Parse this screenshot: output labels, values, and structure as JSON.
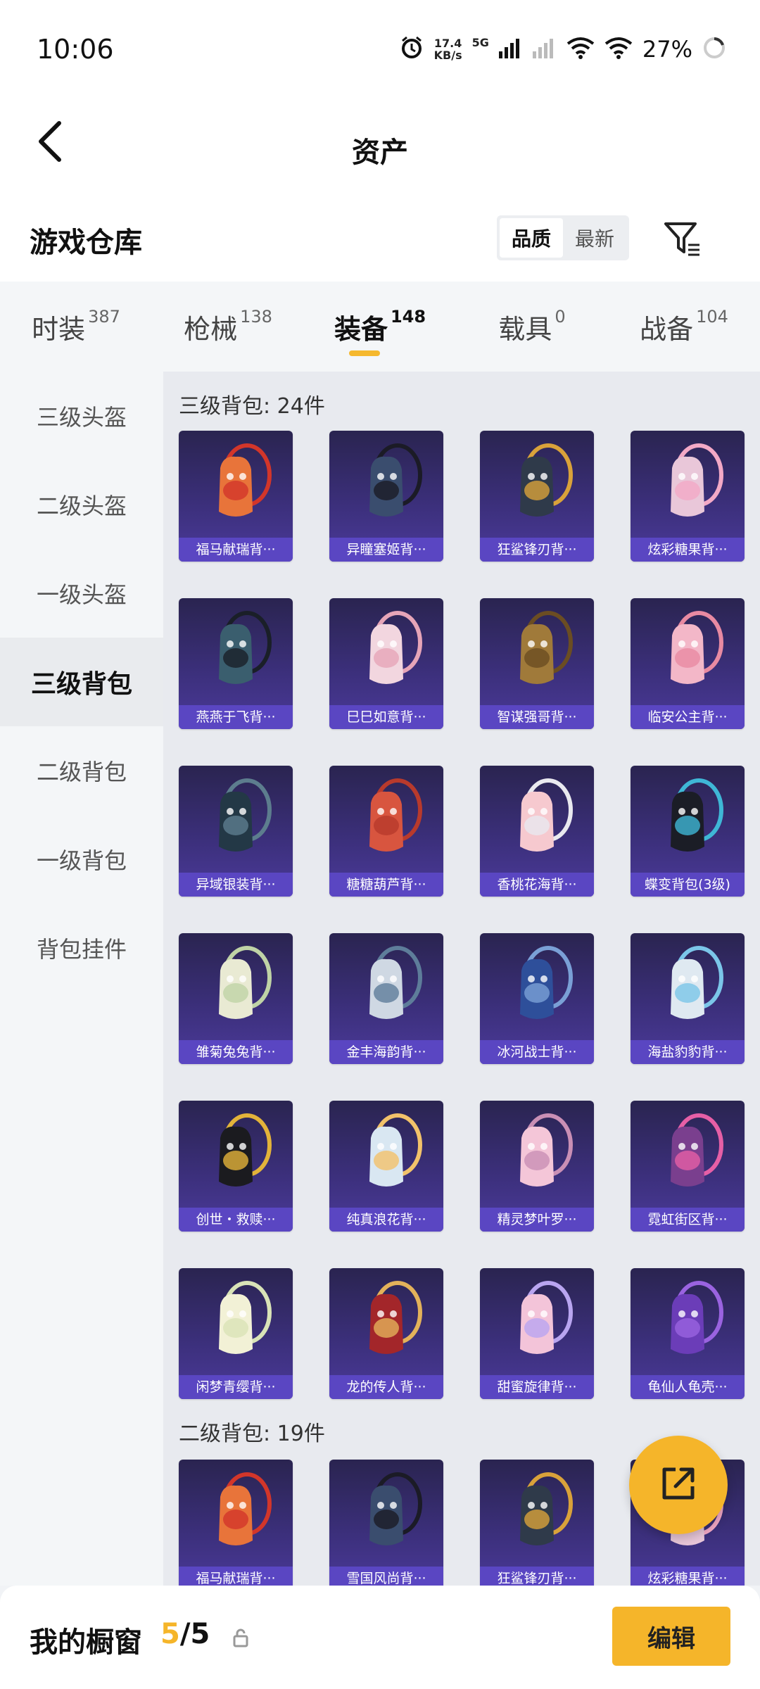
{
  "status_bar": {
    "time": "10:06",
    "net_speed_value": "17.4",
    "net_speed_unit": "KB/s",
    "network_tag": "5G",
    "battery": "27%"
  },
  "header": {
    "title": "资产"
  },
  "warehouse": {
    "title": "游戏仓库",
    "sort_options": [
      "品质",
      "最新"
    ],
    "active_sort": "品质"
  },
  "tabs": [
    {
      "label": "时装",
      "count": "387"
    },
    {
      "label": "枪械",
      "count": "138"
    },
    {
      "label": "装备",
      "count": "148",
      "active": true
    },
    {
      "label": "载具",
      "count": "0"
    },
    {
      "label": "战备",
      "count": "104"
    }
  ],
  "sidebar": {
    "items": [
      "三级头盔",
      "二级头盔",
      "一级头盔",
      "三级背包",
      "二级背包",
      "一级背包",
      "背包挂件"
    ],
    "active": "三级背包"
  },
  "sections": [
    {
      "title": "三级背包: 24件",
      "items": [
        "福马献瑞背···",
        "异瞳塞姬背···",
        "狂鲨锋刃背···",
        "炫彩糖果背···",
        "燕燕于飞背···",
        "巳巳如意背···",
        "智谋强哥背···",
        "临安公主背···",
        "异域银装背···",
        "糖糖葫芦背···",
        "香桃花海背···",
        "蝶变背包(3级)",
        "雏菊兔兔背···",
        "金丰海韵背···",
        "冰河战士背···",
        "海盐豹豹背···",
        "创世・救赎···",
        "纯真浪花背···",
        "精灵梦叶罗···",
        "霓虹街区背···",
        "闲梦青缨背···",
        "龙的传人背···",
        "甜蜜旋律背···",
        "龟仙人龟壳···"
      ]
    },
    {
      "title": "二级背包: 19件",
      "items": [
        "福马献瑞背···",
        "雪国风尚背···",
        "狂鲨锋刃背···",
        "炫彩糖果背···"
      ]
    }
  ],
  "bottom_bar": {
    "title": "我的橱窗",
    "current": "5",
    "total": "/5",
    "edit_label": "编辑"
  },
  "colors": {
    "accent": "#f5b52a",
    "card_bg": "#3b2f7a",
    "card_label_bg": "#5a46c2"
  }
}
